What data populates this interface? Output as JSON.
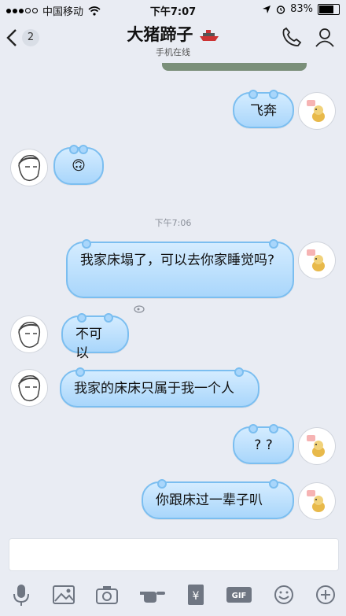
{
  "status_bar": {
    "carrier": "中国移动",
    "time": "下午7:07",
    "battery": "83%",
    "battery_level": 0.83
  },
  "header": {
    "back_count": "2",
    "title": "大猪蹄子",
    "subtitle": "手机在线"
  },
  "messages": [
    {
      "side": "right",
      "text": "飞奔"
    },
    {
      "side": "left",
      "text": "🙃"
    },
    {
      "side": "right",
      "text": "我家床塌了，可以去你家睡觉吗?"
    },
    {
      "side": "left",
      "text": "不可以"
    },
    {
      "side": "left",
      "text": "我家的床床只属于我一个人"
    },
    {
      "side": "right",
      "text": "? ?"
    },
    {
      "side": "right",
      "text": "你跟床过一辈子叭"
    }
  ],
  "timestamp": "下午7:06",
  "toolbar": [
    "microphone-icon",
    "image-icon",
    "camera-icon",
    "poke-icon",
    "red-packet-icon",
    "gif-icon",
    "emoji-icon",
    "plus-icon"
  ],
  "colors": {
    "bubble": "#a9d6fb",
    "bubble_border": "#7bbef0",
    "background": "#e9ecf3"
  }
}
